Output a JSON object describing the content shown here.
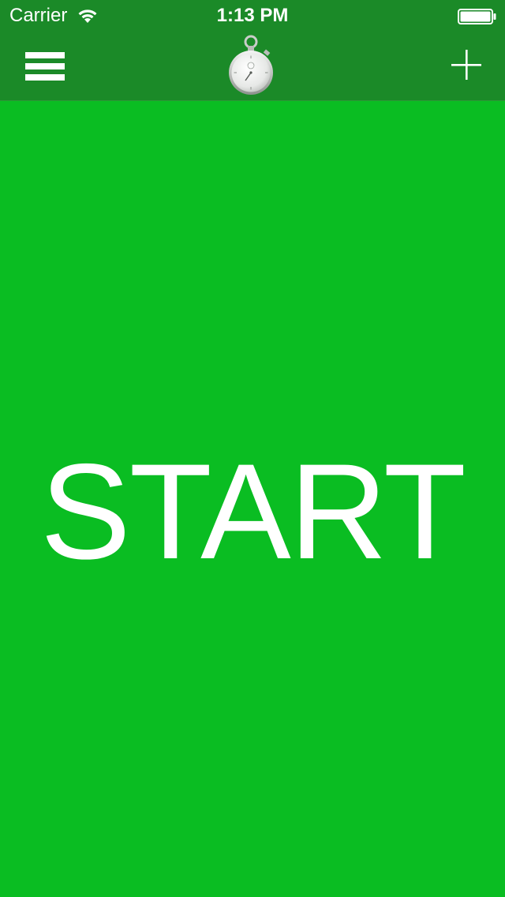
{
  "status_bar": {
    "carrier": "Carrier",
    "time": "1:13 PM",
    "wifi_icon": "wifi-icon",
    "battery_icon": "battery-icon"
  },
  "nav": {
    "menu_icon": "hamburger-menu-icon",
    "logo_icon": "stopwatch-icon",
    "add_icon": "plus-icon"
  },
  "main": {
    "start_label": "START"
  },
  "colors": {
    "header": "#1b8a28",
    "background": "#0abd22",
    "text": "#ffffff"
  }
}
